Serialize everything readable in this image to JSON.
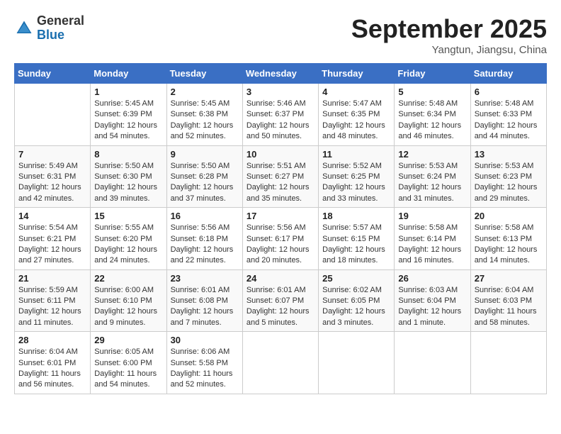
{
  "header": {
    "logo_line1": "General",
    "logo_line2": "Blue",
    "month": "September 2025",
    "location": "Yangtun, Jiangsu, China"
  },
  "weekdays": [
    "Sunday",
    "Monday",
    "Tuesday",
    "Wednesday",
    "Thursday",
    "Friday",
    "Saturday"
  ],
  "weeks": [
    [
      {
        "day": "",
        "info": ""
      },
      {
        "day": "1",
        "info": "Sunrise: 5:45 AM\nSunset: 6:39 PM\nDaylight: 12 hours\nand 54 minutes."
      },
      {
        "day": "2",
        "info": "Sunrise: 5:45 AM\nSunset: 6:38 PM\nDaylight: 12 hours\nand 52 minutes."
      },
      {
        "day": "3",
        "info": "Sunrise: 5:46 AM\nSunset: 6:37 PM\nDaylight: 12 hours\nand 50 minutes."
      },
      {
        "day": "4",
        "info": "Sunrise: 5:47 AM\nSunset: 6:35 PM\nDaylight: 12 hours\nand 48 minutes."
      },
      {
        "day": "5",
        "info": "Sunrise: 5:48 AM\nSunset: 6:34 PM\nDaylight: 12 hours\nand 46 minutes."
      },
      {
        "day": "6",
        "info": "Sunrise: 5:48 AM\nSunset: 6:33 PM\nDaylight: 12 hours\nand 44 minutes."
      }
    ],
    [
      {
        "day": "7",
        "info": "Sunrise: 5:49 AM\nSunset: 6:31 PM\nDaylight: 12 hours\nand 42 minutes."
      },
      {
        "day": "8",
        "info": "Sunrise: 5:50 AM\nSunset: 6:30 PM\nDaylight: 12 hours\nand 39 minutes."
      },
      {
        "day": "9",
        "info": "Sunrise: 5:50 AM\nSunset: 6:28 PM\nDaylight: 12 hours\nand 37 minutes."
      },
      {
        "day": "10",
        "info": "Sunrise: 5:51 AM\nSunset: 6:27 PM\nDaylight: 12 hours\nand 35 minutes."
      },
      {
        "day": "11",
        "info": "Sunrise: 5:52 AM\nSunset: 6:25 PM\nDaylight: 12 hours\nand 33 minutes."
      },
      {
        "day": "12",
        "info": "Sunrise: 5:53 AM\nSunset: 6:24 PM\nDaylight: 12 hours\nand 31 minutes."
      },
      {
        "day": "13",
        "info": "Sunrise: 5:53 AM\nSunset: 6:23 PM\nDaylight: 12 hours\nand 29 minutes."
      }
    ],
    [
      {
        "day": "14",
        "info": "Sunrise: 5:54 AM\nSunset: 6:21 PM\nDaylight: 12 hours\nand 27 minutes."
      },
      {
        "day": "15",
        "info": "Sunrise: 5:55 AM\nSunset: 6:20 PM\nDaylight: 12 hours\nand 24 minutes."
      },
      {
        "day": "16",
        "info": "Sunrise: 5:56 AM\nSunset: 6:18 PM\nDaylight: 12 hours\nand 22 minutes."
      },
      {
        "day": "17",
        "info": "Sunrise: 5:56 AM\nSunset: 6:17 PM\nDaylight: 12 hours\nand 20 minutes."
      },
      {
        "day": "18",
        "info": "Sunrise: 5:57 AM\nSunset: 6:15 PM\nDaylight: 12 hours\nand 18 minutes."
      },
      {
        "day": "19",
        "info": "Sunrise: 5:58 AM\nSunset: 6:14 PM\nDaylight: 12 hours\nand 16 minutes."
      },
      {
        "day": "20",
        "info": "Sunrise: 5:58 AM\nSunset: 6:13 PM\nDaylight: 12 hours\nand 14 minutes."
      }
    ],
    [
      {
        "day": "21",
        "info": "Sunrise: 5:59 AM\nSunset: 6:11 PM\nDaylight: 12 hours\nand 11 minutes."
      },
      {
        "day": "22",
        "info": "Sunrise: 6:00 AM\nSunset: 6:10 PM\nDaylight: 12 hours\nand 9 minutes."
      },
      {
        "day": "23",
        "info": "Sunrise: 6:01 AM\nSunset: 6:08 PM\nDaylight: 12 hours\nand 7 minutes."
      },
      {
        "day": "24",
        "info": "Sunrise: 6:01 AM\nSunset: 6:07 PM\nDaylight: 12 hours\nand 5 minutes."
      },
      {
        "day": "25",
        "info": "Sunrise: 6:02 AM\nSunset: 6:05 PM\nDaylight: 12 hours\nand 3 minutes."
      },
      {
        "day": "26",
        "info": "Sunrise: 6:03 AM\nSunset: 6:04 PM\nDaylight: 12 hours\nand 1 minute."
      },
      {
        "day": "27",
        "info": "Sunrise: 6:04 AM\nSunset: 6:03 PM\nDaylight: 11 hours\nand 58 minutes."
      }
    ],
    [
      {
        "day": "28",
        "info": "Sunrise: 6:04 AM\nSunset: 6:01 PM\nDaylight: 11 hours\nand 56 minutes."
      },
      {
        "day": "29",
        "info": "Sunrise: 6:05 AM\nSunset: 6:00 PM\nDaylight: 11 hours\nand 54 minutes."
      },
      {
        "day": "30",
        "info": "Sunrise: 6:06 AM\nSunset: 5:58 PM\nDaylight: 11 hours\nand 52 minutes."
      },
      {
        "day": "",
        "info": ""
      },
      {
        "day": "",
        "info": ""
      },
      {
        "day": "",
        "info": ""
      },
      {
        "day": "",
        "info": ""
      }
    ]
  ]
}
